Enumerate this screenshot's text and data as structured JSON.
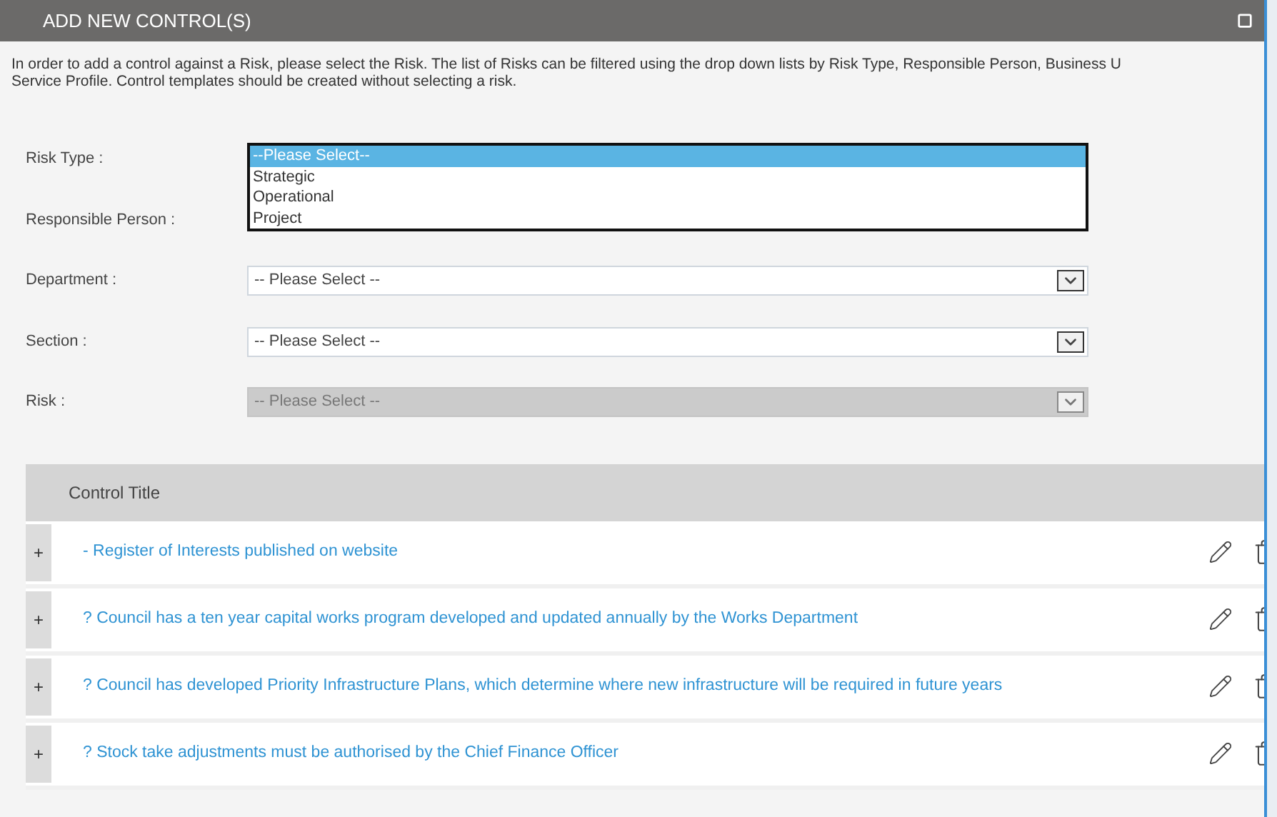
{
  "dialog": {
    "title": "ADD NEW CONTROL(S)"
  },
  "intro": [
    "In order to add a control against a Risk, please select the Risk. The list of Risks can be filtered using the drop down lists by Risk Type, Responsible Person, Business U",
    "Service Profile. Control templates should be created without selecting a risk."
  ],
  "fields": [
    {
      "label": "Risk Type :",
      "kind": "listbox",
      "options": [
        {
          "label": "--Please Select--",
          "selected": true
        },
        {
          "label": "Strategic",
          "selected": false
        },
        {
          "label": "Operational",
          "selected": false
        },
        {
          "label": "Project",
          "selected": false
        }
      ]
    },
    {
      "label": "Responsible Person :",
      "kind": "covered"
    },
    {
      "label": "Department :",
      "kind": "select",
      "value": "-- Please Select --",
      "disabled": false
    },
    {
      "label": "Section :",
      "kind": "select",
      "value": "-- Please Select --",
      "disabled": false
    },
    {
      "label": "Risk :",
      "kind": "select",
      "value": "-- Please Select --",
      "disabled": true
    }
  ],
  "table": {
    "columns": [
      "Control Title"
    ],
    "rows": [
      {
        "expander": "+",
        "title": "- Register of Interests published on website"
      },
      {
        "expander": "+",
        "title": "? Council has a ten year capital works program developed and updated annually by the Works Department"
      },
      {
        "expander": "+",
        "title": "? Council has developed Priority Infrastructure Plans, which determine where new infrastructure will be required in future years"
      },
      {
        "expander": "+",
        "title": "? Stock take adjustments must be authorised by the Chief Finance Officer"
      }
    ]
  }
}
